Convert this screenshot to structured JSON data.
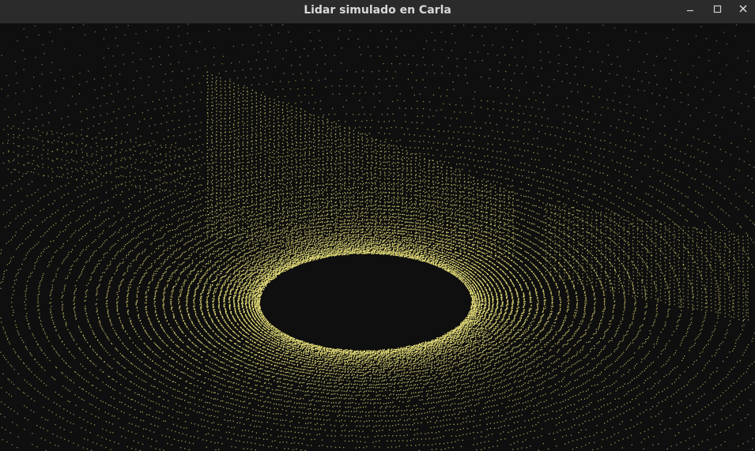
{
  "window": {
    "title": "Lidar simulado en Carla",
    "controls": [
      {
        "name": "minimize",
        "icon": "minimize-icon"
      },
      {
        "name": "maximize",
        "icon": "maximize-icon"
      },
      {
        "name": "close",
        "icon": "close-icon"
      }
    ]
  },
  "scene": {
    "background_color": "#0f0f0f",
    "point_color": "#e8e07a",
    "highlight_point_color": "#e0a440",
    "titlebar_color": "#2b2b2b"
  }
}
